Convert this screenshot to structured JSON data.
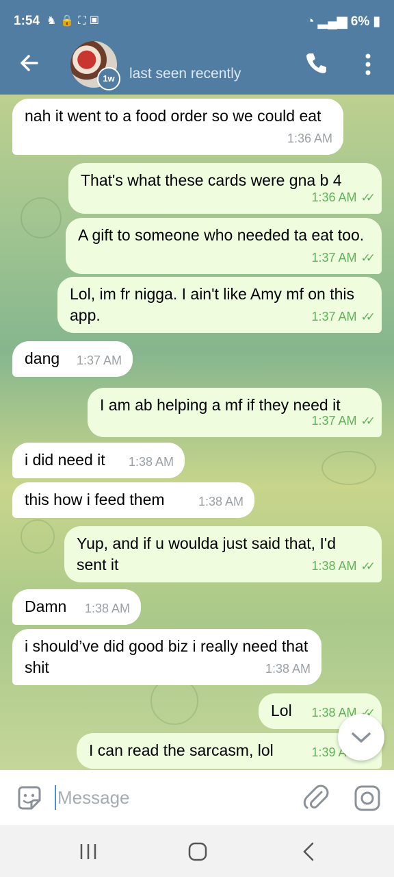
{
  "status_bar": {
    "time": "1:54",
    "icons": [
      "game-icon",
      "lock-icon",
      "screenshot-icon",
      "image-icon"
    ],
    "battery": "6%"
  },
  "header": {
    "avatar_badge": "1w",
    "status": "last seen recently"
  },
  "messages": [
    {
      "dir": "in",
      "text": "nah it went to a food order so we could eat",
      "time": "1:36 AM"
    },
    {
      "dir": "out",
      "text": "That's what these cards were gna b 4",
      "time": "1:36 AM",
      "read": true
    },
    {
      "dir": "out",
      "text": "A gift to someone who needed ta eat too.",
      "time": "1:37 AM",
      "read": true
    },
    {
      "dir": "out",
      "text": "Lol, im fr nigga.   I ain't like Amy mf on this app.",
      "time": "1:37 AM",
      "read": true
    },
    {
      "dir": "in",
      "text": "dang",
      "time": "1:37 AM"
    },
    {
      "dir": "out",
      "text": "I am ab helping a mf if they need it",
      "time": "1:37 AM",
      "read": true
    },
    {
      "dir": "in",
      "text": "i did need it",
      "time": "1:38 AM"
    },
    {
      "dir": "in",
      "text": "this how i feed them",
      "time": "1:38 AM"
    },
    {
      "dir": "out",
      "text": "Yup, and if u woulda just said that, I'd sent it",
      "time": "1:38 AM",
      "read": true
    },
    {
      "dir": "in",
      "text": "Damn",
      "time": "1:38 AM"
    },
    {
      "dir": "in",
      "text": "i should’ve did good biz i really need that shit",
      "time": "1:38 AM"
    },
    {
      "dir": "out",
      "text": "Lol",
      "time": "1:38 AM",
      "read": true
    },
    {
      "dir": "out",
      "text": "I can read the sarcasm, lol",
      "time": "1:39 AM",
      "read": true
    }
  ],
  "composer": {
    "placeholder": "Message"
  },
  "colors": {
    "header": "#517da2",
    "outgoing_bubble": "#effdde",
    "incoming_bubble": "#ffffff",
    "read_check": "#5fb25a"
  }
}
